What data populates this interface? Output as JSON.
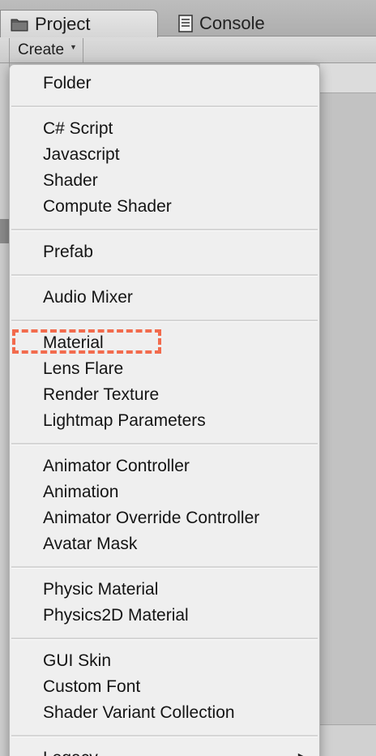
{
  "tabs": [
    {
      "label": "Project",
      "icon": "folder-icon"
    },
    {
      "label": "Console",
      "icon": "console-icon"
    }
  ],
  "toolbar": {
    "create_label": "Create",
    "caret": "▼"
  },
  "menu": {
    "item_groups": [
      [
        "Folder"
      ],
      [
        "C# Script",
        "Javascript",
        "Shader",
        "Compute Shader"
      ],
      [
        "Prefab"
      ],
      [
        "Audio Mixer"
      ],
      [
        "Material",
        "Lens Flare",
        "Render Texture",
        "Lightmap Parameters"
      ],
      [
        "Animator Controller",
        "Animation",
        "Animator Override Controller",
        "Avatar Mask"
      ],
      [
        "Physic Material",
        "Physics2D Material"
      ],
      [
        "GUI Skin",
        "Custom Font",
        "Shader Variant Collection"
      ],
      [
        "Legacy"
      ]
    ],
    "submenu_arrow": "▶"
  },
  "highlight": {
    "item": "Material",
    "color": "#f26b4d"
  }
}
